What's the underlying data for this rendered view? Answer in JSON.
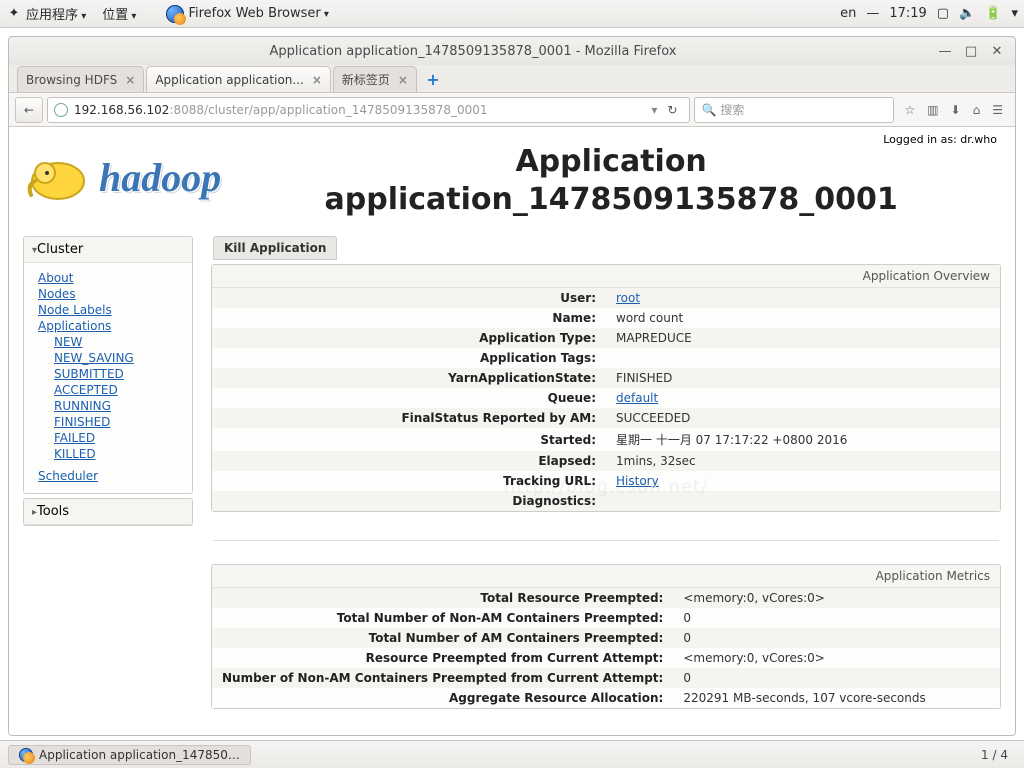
{
  "desktop": {
    "menu_apps": "应用程序",
    "menu_places": "位置",
    "firefox_label": "Firefox Web Browser",
    "lang": "en",
    "clock": "17:19"
  },
  "window": {
    "title": "Application application_1478509135878_0001 - Mozilla Firefox",
    "tabs": [
      {
        "label": "Browsing HDFS"
      },
      {
        "label": "Application application..."
      },
      {
        "label": "新标签页"
      }
    ],
    "url_host": "192.168.56.102",
    "url_rest": ":8088/cluster/app/application_1478509135878_0001",
    "search_placeholder": "搜索"
  },
  "page": {
    "login_text": "Logged in as: dr.who",
    "logo_text": "hadoop",
    "title_line1": "Application",
    "title_line2": "application_1478509135878_0001",
    "watermark": "http://blog.csdn.net/"
  },
  "sidebar": {
    "cluster_header": "Cluster",
    "tools_header": "Tools",
    "cluster_links": [
      "About",
      "Nodes",
      "Node Labels",
      "Applications"
    ],
    "app_state_links": [
      "NEW",
      "NEW_SAVING",
      "SUBMITTED",
      "ACCEPTED",
      "RUNNING",
      "FINISHED",
      "FAILED",
      "KILLED"
    ],
    "scheduler_link": "Scheduler"
  },
  "kill_label": "Kill Application",
  "overview": {
    "header": "Application Overview",
    "rows": {
      "user_k": "User:",
      "user_v": "root",
      "user_link": true,
      "name_k": "Name:",
      "name_v": "word count",
      "type_k": "Application Type:",
      "type_v": "MAPREDUCE",
      "tags_k": "Application Tags:",
      "tags_v": "",
      "state_k": "YarnApplicationState:",
      "state_v": "FINISHED",
      "queue_k": "Queue:",
      "queue_v": "default",
      "queue_link": true,
      "final_k": "FinalStatus Reported by AM:",
      "final_v": "SUCCEEDED",
      "started_k": "Started:",
      "started_v": "星期一 十一月 07 17:17:22 +0800 2016",
      "elapsed_k": "Elapsed:",
      "elapsed_v": "1mins, 32sec",
      "track_k": "Tracking URL:",
      "track_v": "History",
      "track_link": true,
      "diag_k": "Diagnostics:",
      "diag_v": ""
    }
  },
  "metrics": {
    "header": "Application Metrics",
    "rows": {
      "r1k": "Total Resource Preempted:",
      "r1v": "<memory:0, vCores:0>",
      "r2k": "Total Number of Non-AM Containers Preempted:",
      "r2v": "0",
      "r3k": "Total Number of AM Containers Preempted:",
      "r3v": "0",
      "r4k": "Resource Preempted from Current Attempt:",
      "r4v": "<memory:0, vCores:0>",
      "r5k": "Number of Non-AM Containers Preempted from Current Attempt:",
      "r5v": "0",
      "r6k": "Aggregate Resource Allocation:",
      "r6v": "220291 MB-seconds, 107 vcore-seconds"
    }
  },
  "taskbar": {
    "running": "Application application_147850…",
    "pager": "1 / 4"
  }
}
